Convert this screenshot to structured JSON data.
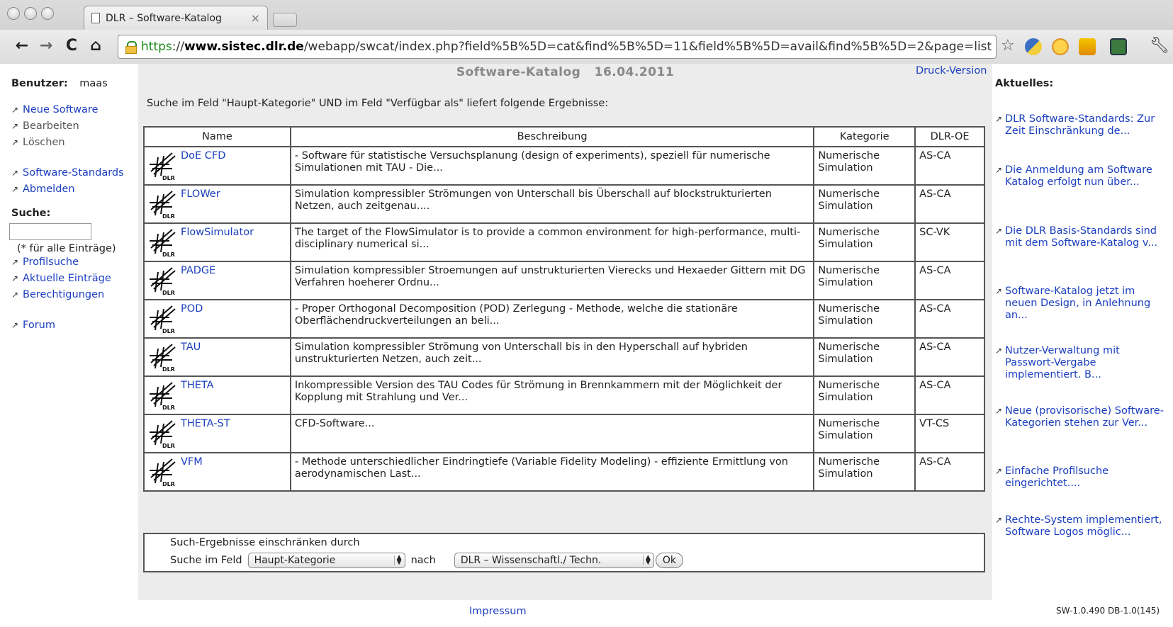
{
  "browser": {
    "tab_title": "DLR – Software-Katalog",
    "tab_close": "×",
    "url_scheme": "https",
    "url_sep": "://",
    "url_host": "www.sistec.dlr.de",
    "url_path": "/webapp/swcat/index.php?field%5B%5D=cat&find%5B%5D=11&field%5B%5D=avail&find%5B%5D=2&page=list",
    "icons": [
      "back-icon",
      "forward-icon",
      "reload-icon",
      "home-icon",
      "lock-icon",
      "star-icon",
      "python-extension-icon",
      "emoji-extension-icon",
      "bookmark-extension-icon",
      "green-extension-icon",
      "wrench-icon"
    ]
  },
  "left_nav": {
    "user_label": "Benutzer:",
    "user_name": "maas",
    "links_1": [
      "Neue Software",
      "Bearbeiten",
      "Löschen"
    ],
    "links_2": [
      "Software-Standards",
      "Abmelden"
    ],
    "search_label": "Suche:",
    "search_hint": "(* für alle Einträge)",
    "links_3": [
      "Profilsuche",
      "Aktuelle Einträge",
      "Berechtigungen"
    ],
    "links_4": [
      "Forum"
    ]
  },
  "header": {
    "title": "Software-Katalog   16.04.2011",
    "druck": "Druck-Version"
  },
  "result_text": "Suche im Feld \"Haupt-Kategorie\" UND im Feld \"Verfügbar als\" liefert folgende Ergebnisse:",
  "table": {
    "headers": [
      "Name",
      "Beschreibung",
      "Kategorie",
      "DLR-OE"
    ],
    "logo_text": "DLR",
    "rows": [
      {
        "name": "DoE CFD",
        "desc": "- Software für statistische Versuchsplanung (design of experiments), speziell für numerische Simulationen mit TAU - Die...",
        "cat": "Numerische Simulation",
        "oe": "AS-CA"
      },
      {
        "name": "FLOWer",
        "desc": "Simulation kompressibler Strömungen von Unterschall bis Überschall auf blockstrukturierten Netzen, auch zeitgenau....",
        "cat": "Numerische Simulation",
        "oe": "AS-CA"
      },
      {
        "name": "FlowSimulator",
        "desc": "The target of the FlowSimulator is to provide a common environment for high-performance, multi-disciplinary numerical si...",
        "cat": "Numerische Simulation",
        "oe": "SC-VK"
      },
      {
        "name": "PADGE",
        "desc": "Simulation kompressibler Stroemungen auf unstrukturierten Vierecks und Hexaeder Gittern mit DG Verfahren hoeherer Ordnu...",
        "cat": "Numerische Simulation",
        "oe": "AS-CA"
      },
      {
        "name": "POD",
        "desc": "- Proper Orthogonal Decomposition (POD) Zerlegung - Methode, welche die stationäre Oberflächendruckverteilungen an beli...",
        "cat": "Numerische Simulation",
        "oe": "AS-CA"
      },
      {
        "name": "TAU",
        "desc": "Simulation kompressibler Strömung von Unterschall bis in den Hyperschall auf hybriden unstrukturierten Netzen, auch zeit...",
        "cat": "Numerische Simulation",
        "oe": "AS-CA"
      },
      {
        "name": "THETA",
        "desc": "Inkompressible Version des TAU Codes für Strömung in Brennkammern mit der Möglichkeit der Kopplung mit Strahlung und Ver...",
        "cat": "Numerische Simulation",
        "oe": "AS-CA"
      },
      {
        "name": "THETA-ST",
        "desc": "CFD-Software...",
        "cat": "Numerische Simulation",
        "oe": "VT-CS"
      },
      {
        "name": "VFM",
        "desc": "- Methode unterschiedlicher Eindringtiefe (Variable Fidelity Modeling) - effiziente Ermittlung von aerodynamischen Last...",
        "cat": "Numerische Simulation",
        "oe": "AS-CA"
      }
    ]
  },
  "filter": {
    "title": "Such-Ergebnisse einschränken durch",
    "field_label": "Suche im Feld",
    "field_value": "Haupt-Kategorie",
    "nach_label": "nach",
    "value_select": "DLR – Wissenschaftl./ Techn.",
    "ok": "Ok"
  },
  "footer": {
    "impressum": "Impressum",
    "version": "SW-1.0.490 DB-1.0(145)"
  },
  "news": {
    "heading": "Aktuelles:",
    "items": [
      "DLR Software-Standards: Zur Zeit Einschränkung de...",
      "Die Anmeldung am Software Katalog erfolgt nun über...",
      "Die DLR Basis-Standards sind mit dem Software-Katalog v...",
      "Software-Katalog jetzt im neuen Design, in Anlehnung an...",
      "Nutzer-Verwaltung mit Passwort-Vergabe implementiert. B...",
      "Neue (provisorische) Software-Kategorien stehen zur Ver...",
      "Einfache Profilsuche eingerichtet....",
      "Rechte-System implementiert, Software Logos möglic..."
    ]
  },
  "colors": {
    "link": "#1b3fbf",
    "content_bg": "#ececec",
    "url_secure": "#1a8a1a"
  }
}
